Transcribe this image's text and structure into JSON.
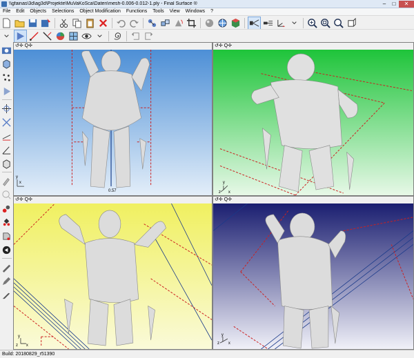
{
  "window": {
    "title": "\\\\gfainas\\3d\\ag3d\\Projekte\\MuVaKoSca\\Daten\\mesh-0.006-0.012-1.ply - Final Surface ®",
    "min_glyph": "–",
    "max_glyph": "□",
    "close_glyph": "✕"
  },
  "menu": [
    "File",
    "Edit",
    "Objects",
    "Selections",
    "Object Modification",
    "Functions",
    "Tools",
    "View",
    "Windows",
    "?"
  ],
  "viewports": {
    "front": {
      "controls": "↺✢ Q✢",
      "axis_x": "x",
      "axis_y": "y",
      "dimension_label": "0.57"
    },
    "perspective": {
      "controls": "↺✢ Q✢",
      "axis_x": "x",
      "axis_y": "y",
      "axis_z": "z"
    },
    "back": {
      "controls": "↺✢ Q✢",
      "axis_x": "x",
      "axis_y": "y",
      "axis_z": "z"
    },
    "isometric": {
      "controls": "↺✢ Q✢",
      "axis_x": "x",
      "axis_y": "y",
      "axis_z": "z"
    }
  },
  "status": {
    "build": "Build: 20180829_r51390"
  },
  "colors": {
    "front_bg_top": "#4d8fd6",
    "front_bg_bottom": "#e3eef9",
    "persp_bg_top": "#1ec43a",
    "persp_bg_bottom": "#e7f8e7",
    "back_bg_top": "#f0f060",
    "back_bg_bottom": "#fafad9",
    "iso_bg_top": "#1a1e70",
    "iso_bg_bottom": "#f0f0f8",
    "dashed_red": "#cc2020",
    "mesh": "#dcdcdc"
  }
}
